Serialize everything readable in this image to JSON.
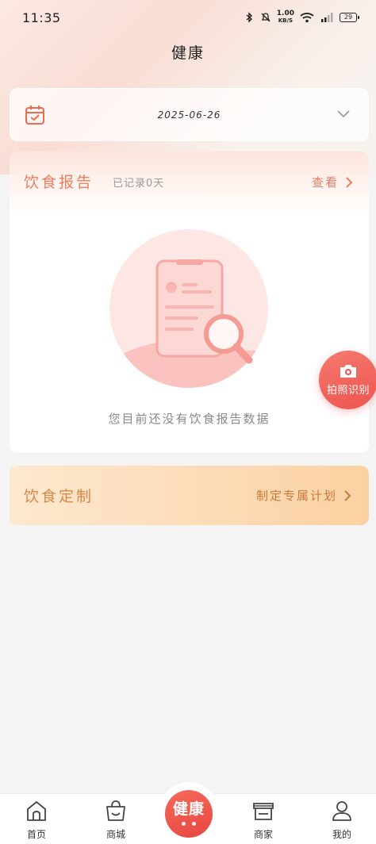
{
  "status_bar": {
    "time": "11:35",
    "speed_value": "1.00",
    "speed_unit": "KB/S",
    "battery": "29"
  },
  "header": {
    "title": "健康"
  },
  "date_picker": {
    "date": "2025-06-26"
  },
  "diet_report": {
    "title": "饮食报告",
    "subtitle": "已记录0天",
    "view_label": "查看",
    "empty_text": "您目前还没有饮食报告数据"
  },
  "photo_fab": {
    "label": "拍照识别"
  },
  "diet_custom": {
    "title": "饮食定制",
    "action_label": "制定专属计划"
  },
  "tabbar": {
    "items": [
      {
        "label": "首页",
        "icon": "home-icon"
      },
      {
        "label": "商城",
        "icon": "shopping-bag-icon"
      },
      {
        "label": "健康",
        "icon": "health-center-button"
      },
      {
        "label": "商家",
        "icon": "store-icon"
      },
      {
        "label": "我的",
        "icon": "user-icon"
      }
    ]
  },
  "colors": {
    "accent": "#ee7d61",
    "fab": "#ef5350",
    "custom_text": "#d98847"
  }
}
